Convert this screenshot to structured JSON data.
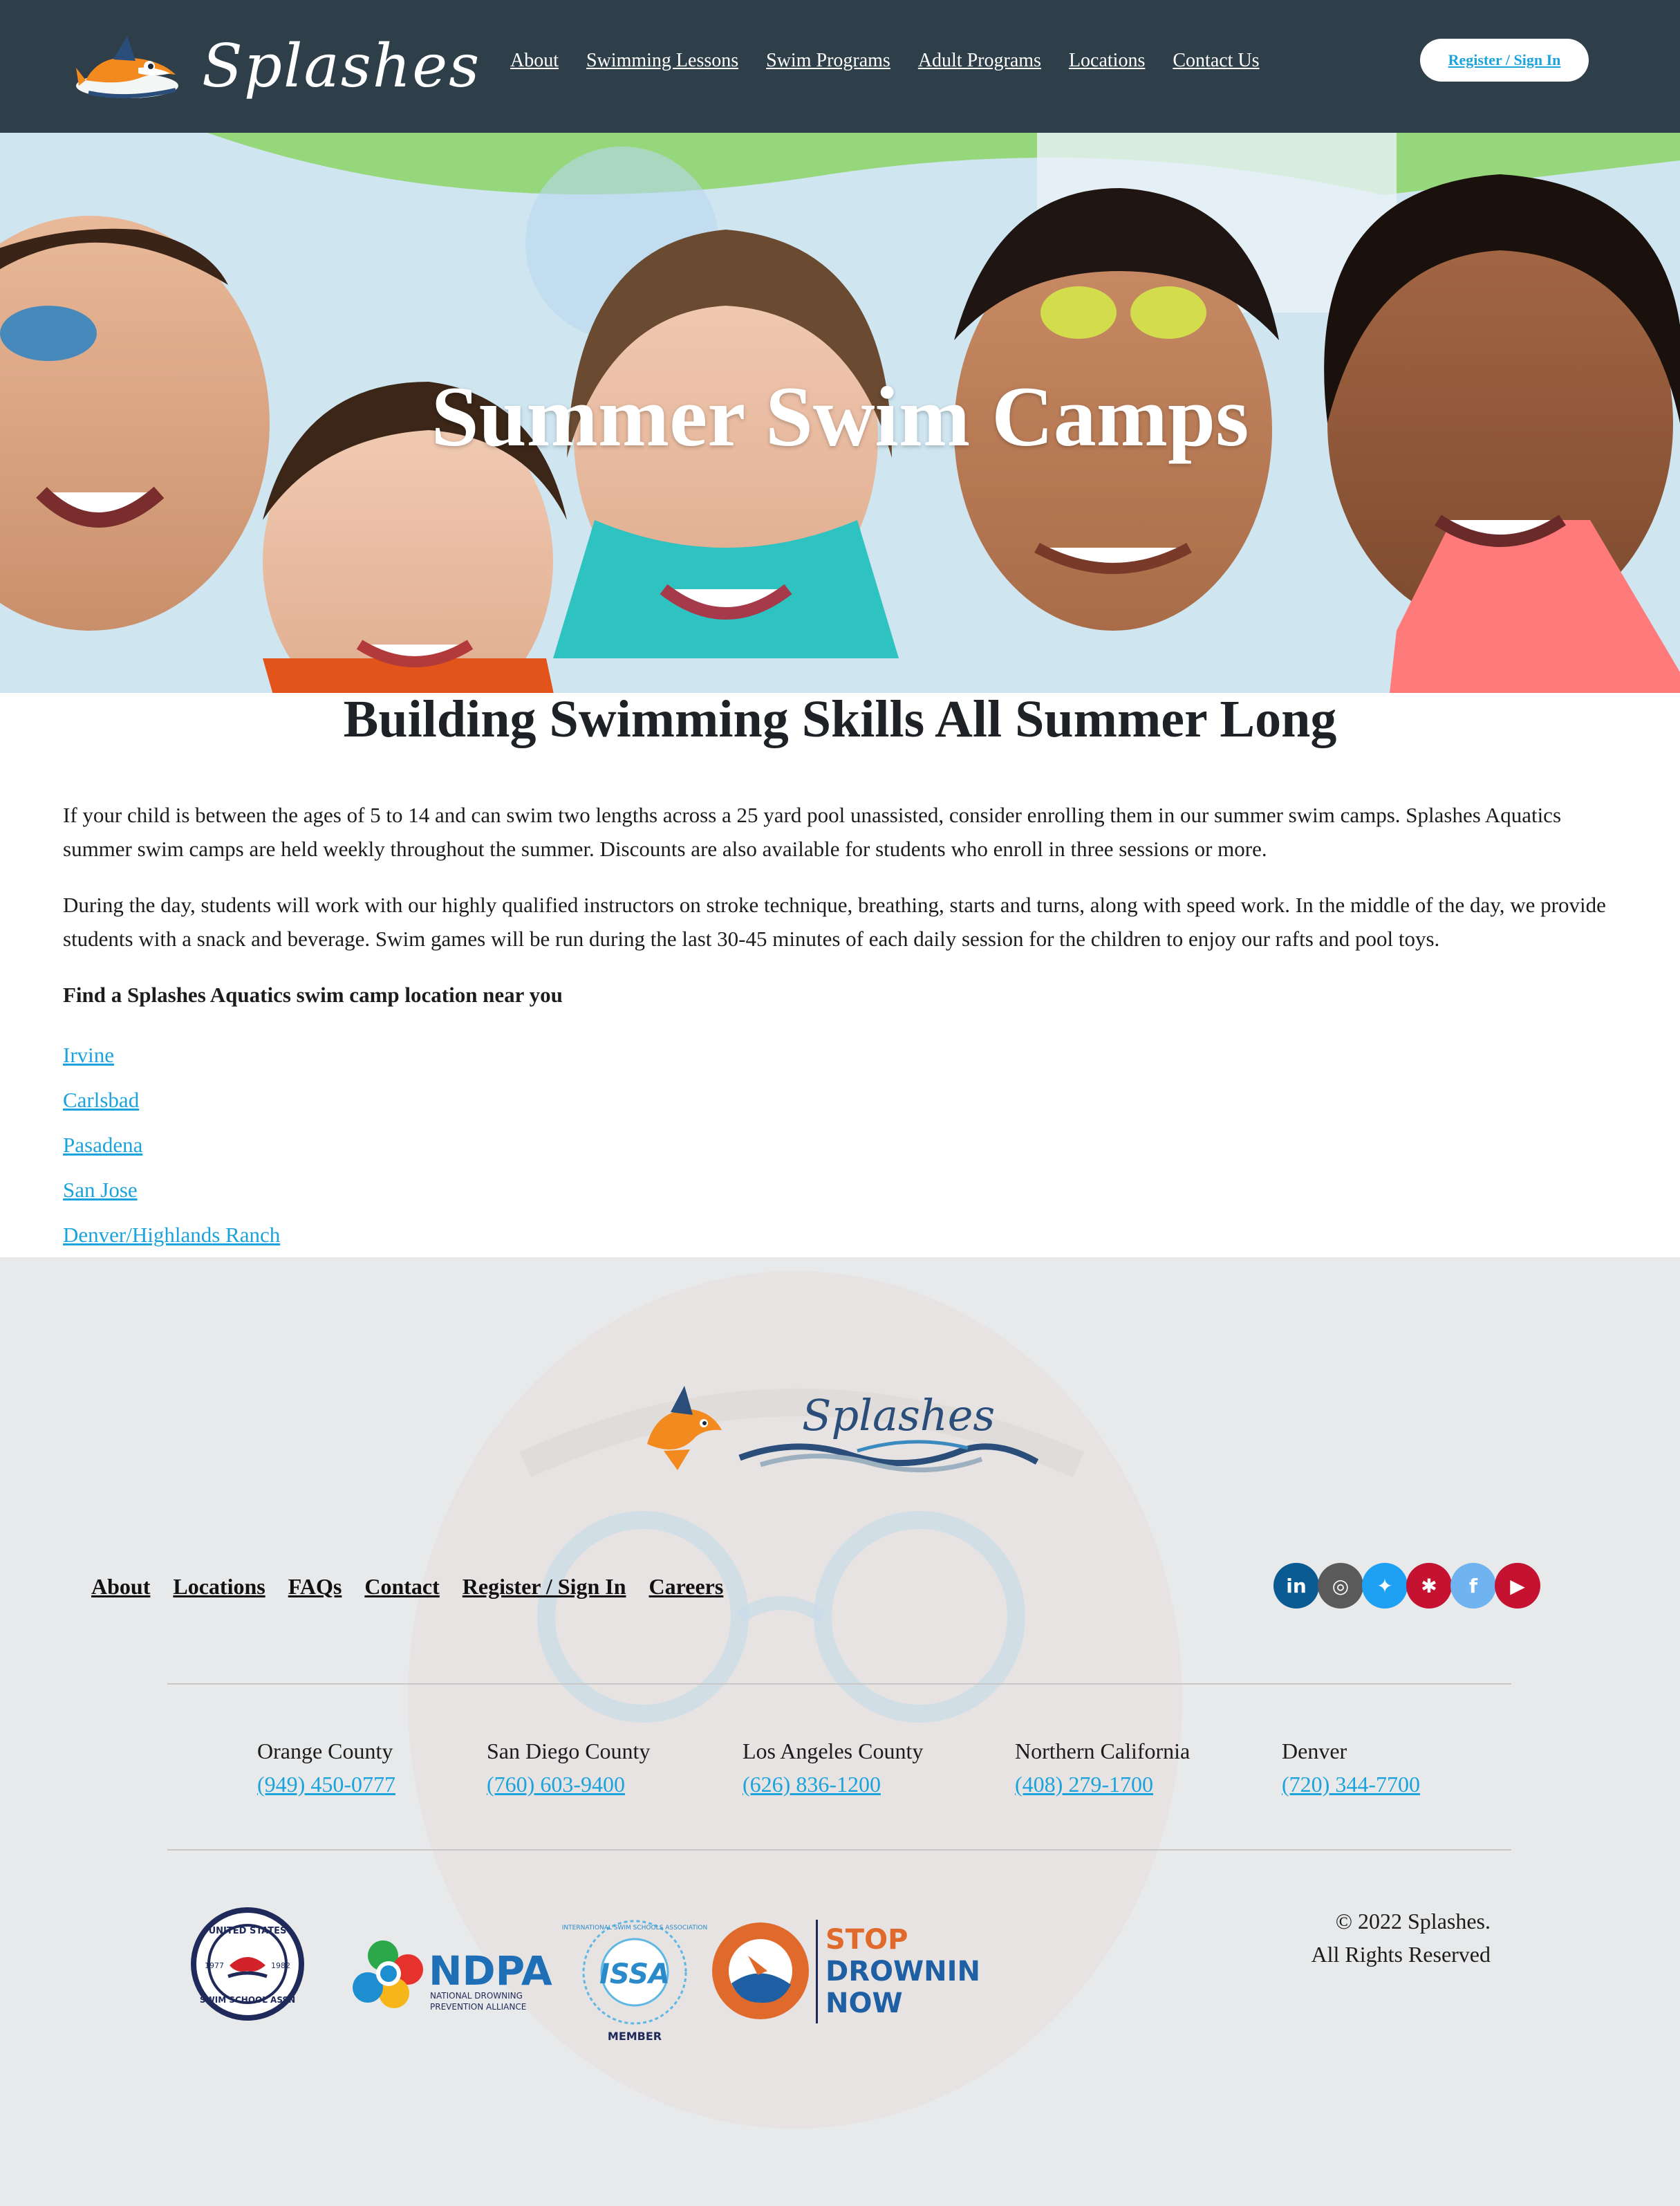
{
  "header": {
    "logo_text": "Splashes",
    "nav": [
      "About",
      "Swimming Lessons",
      "Swim Programs",
      "Adult Programs",
      "Locations",
      "Contact Us"
    ],
    "register_label": "Register / Sign In"
  },
  "hero": {
    "title": "Summer Swim Camps"
  },
  "main": {
    "heading": "Building Swimming Skills All Summer Long",
    "paragraph1": "If your child is between the ages of 5 to 14 and can swim two lengths across a 25 yard pool unassisted, consider enrolling them in our summer swim camps. Splashes Aquatics summer swim camps are held weekly throughout the summer. Discounts are also available for students who enroll in three sessions or more.",
    "paragraph2": "During the day, students will work with our highly qualified instructors on stroke technique, breathing, starts and turns, along with speed work. In the middle of the day, we provide students with a snack and beverage. Swim games will be run during the last 30-45 minutes of each daily session for the children to enjoy our rafts and pool toys.",
    "find_heading": "Find a Splashes Aquatics swim camp location near you",
    "locations": [
      "Irvine",
      "Carlsbad",
      "Pasadena",
      "San Jose",
      "Denver/Highlands Ranch"
    ]
  },
  "footer": {
    "logo_text": "Splashes",
    "nav": [
      "About",
      "Locations",
      "FAQs",
      "Contact",
      "Register / Sign In",
      "Careers"
    ],
    "social": [
      {
        "icon": "linkedin-icon",
        "glyph": "in",
        "color": "#0a5a93"
      },
      {
        "icon": "instagram-icon",
        "glyph": "◎",
        "color": "#5a5a5a"
      },
      {
        "icon": "twitter-icon",
        "glyph": "✦",
        "color": "#1ea1f2"
      },
      {
        "icon": "yelp-icon",
        "glyph": "✱",
        "color": "#c41230"
      },
      {
        "icon": "facebook-icon",
        "glyph": "f",
        "color": "#6fb3f0"
      },
      {
        "icon": "youtube-icon",
        "glyph": "▶",
        "color": "#c41230"
      }
    ],
    "regions": [
      {
        "name": "Orange County",
        "phone": "(949) 450-0777"
      },
      {
        "name": "San Diego County",
        "phone": "(760) 603-9400"
      },
      {
        "name": "Los Angeles County",
        "phone": "(626) 836-1200"
      },
      {
        "name": "Northern California",
        "phone": "(408) 279-1700"
      },
      {
        "name": "Denver",
        "phone": "(720) 344-7700"
      }
    ],
    "badges": {
      "usssa": {
        "top": "UNITED STATES",
        "bottom": "SWIM SCHOOL ASSN",
        "year1": "1977",
        "year2": "1982"
      },
      "ndpa": {
        "title": "NDPA",
        "sub1": "NATIONAL DROWNING",
        "sub2": "PREVENTION ALLIANCE"
      },
      "issa": {
        "title": "ISSA",
        "ring": "INTERNATIONAL SWIM SCHOOLS ASSOCIATION",
        "member": "MEMBER"
      },
      "sdn": {
        "line1": "STOP",
        "line2": "DROWNING",
        "line3": "NOW"
      }
    },
    "copyright_line1": "© 2022 Splashes.",
    "copyright_line2": "All Rights Reserved",
    "colors": {
      "link": "#1ca3dc",
      "header_bg": "#2e3f49"
    }
  }
}
